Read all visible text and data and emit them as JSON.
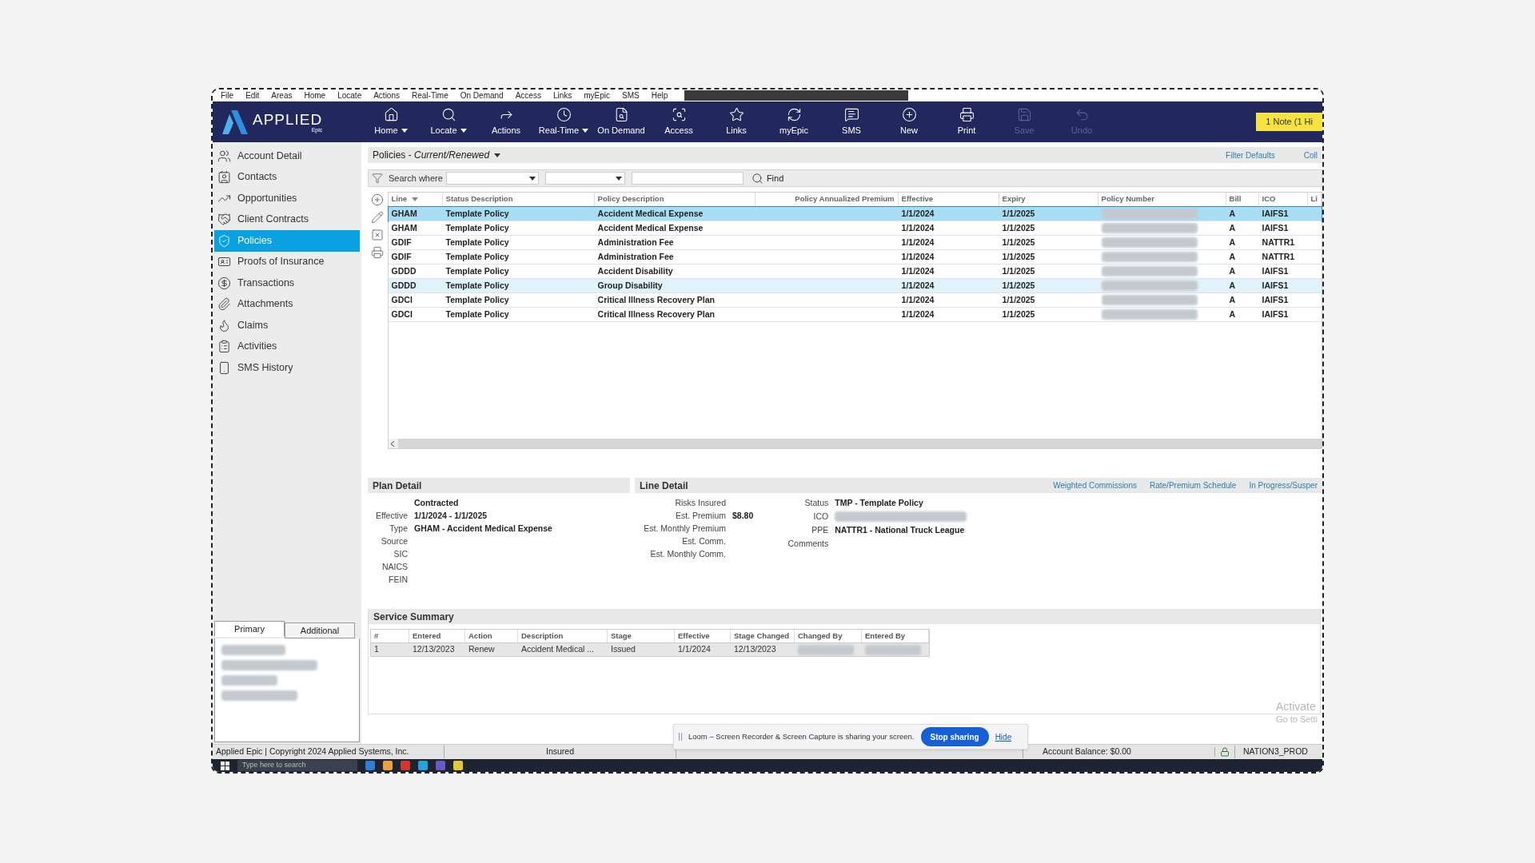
{
  "menu_bar": [
    "File",
    "Edit",
    "Areas",
    "Home",
    "Locate",
    "Actions",
    "Real-Time",
    "On Demand",
    "Access",
    "Links",
    "myEpic",
    "SMS",
    "Help"
  ],
  "toolbar": {
    "logo": "APPLIED",
    "logo_sub": "Epic",
    "buttons": [
      {
        "label": "Home",
        "dropdown": true,
        "disabled": false
      },
      {
        "label": "Locate",
        "dropdown": true,
        "disabled": false
      },
      {
        "label": "Actions",
        "dropdown": false,
        "disabled": false
      },
      {
        "label": "Real-Time",
        "dropdown": true,
        "disabled": false
      },
      {
        "label": "On Demand",
        "dropdown": false,
        "disabled": false
      },
      {
        "label": "Access",
        "dropdown": false,
        "disabled": false
      },
      {
        "label": "Links",
        "dropdown": false,
        "disabled": false
      },
      {
        "label": "myEpic",
        "dropdown": false,
        "disabled": false
      },
      {
        "label": "SMS",
        "dropdown": false,
        "disabled": false
      },
      {
        "label": "New",
        "dropdown": false,
        "disabled": false
      },
      {
        "label": "Print",
        "dropdown": false,
        "disabled": false
      },
      {
        "label": "Save",
        "dropdown": false,
        "disabled": true
      },
      {
        "label": "Undo",
        "dropdown": false,
        "disabled": true
      }
    ],
    "note_badge": "1 Note (1 Hi"
  },
  "sidebar": {
    "items": [
      {
        "label": "Account Detail",
        "selected": false
      },
      {
        "label": "Contacts",
        "selected": false
      },
      {
        "label": "Opportunities",
        "selected": false
      },
      {
        "label": "Client Contracts",
        "selected": false
      },
      {
        "label": "Policies",
        "selected": true
      },
      {
        "label": "Proofs of Insurance",
        "selected": false
      },
      {
        "label": "Transactions",
        "selected": false
      },
      {
        "label": "Attachments",
        "selected": false
      },
      {
        "label": "Claims",
        "selected": false
      },
      {
        "label": "Activities",
        "selected": false
      },
      {
        "label": "SMS History",
        "selected": false
      }
    ],
    "tabs": [
      {
        "label": "Primary",
        "selected": true
      },
      {
        "label": "Additional",
        "selected": false
      }
    ]
  },
  "policies": {
    "title": "Policies - *Current/Renewed*",
    "links": [
      "Filter Defaults",
      "Coll"
    ],
    "search": {
      "label": "Search where",
      "find": "Find"
    },
    "table": {
      "columns": [
        "Line",
        "Status Description",
        "Policy Description",
        "Policy Annualized Premium",
        "Effective",
        "Expiry",
        "Policy Number",
        "Bill",
        "ICO",
        "Li"
      ],
      "rows": [
        {
          "line": "GHAM",
          "status": "Template Policy",
          "description": "Accident Medical Expense",
          "effective": "1/1/2024",
          "expiry": "1/1/2025",
          "bill": "A",
          "ico": "IAIFS1",
          "selected": true,
          "hovered": false
        },
        {
          "line": "GHAM",
          "status": "Template Policy",
          "description": "Accident Medical Expense",
          "effective": "1/1/2024",
          "expiry": "1/1/2025",
          "bill": "A",
          "ico": "IAIFS1",
          "selected": false,
          "hovered": false
        },
        {
          "line": "GDIF",
          "status": "Template Policy",
          "description": "Administration Fee",
          "effective": "1/1/2024",
          "expiry": "1/1/2025",
          "bill": "A",
          "ico": "NATTR1",
          "selected": false,
          "hovered": false
        },
        {
          "line": "GDIF",
          "status": "Template Policy",
          "description": "Administration Fee",
          "effective": "1/1/2024",
          "expiry": "1/1/2025",
          "bill": "A",
          "ico": "NATTR1",
          "selected": false,
          "hovered": false
        },
        {
          "line": "GDDD",
          "status": "Template Policy",
          "description": "Accident Disability",
          "effective": "1/1/2024",
          "expiry": "1/1/2025",
          "bill": "A",
          "ico": "IAIFS1",
          "selected": false,
          "hovered": false
        },
        {
          "line": "GDDD",
          "status": "Template Policy",
          "description": "Group Disability",
          "effective": "1/1/2024",
          "expiry": "1/1/2025",
          "bill": "A",
          "ico": "IAIFS1",
          "selected": false,
          "hovered": true
        },
        {
          "line": "GDCI",
          "status": "Template Policy",
          "description": "Critical Illness Recovery Plan",
          "effective": "1/1/2024",
          "expiry": "1/1/2025",
          "bill": "A",
          "ico": "IAIFS1",
          "selected": false,
          "hovered": false
        },
        {
          "line": "GDCI",
          "status": "Template Policy",
          "description": "Critical Illness Recovery Plan",
          "effective": "1/1/2024",
          "expiry": "1/1/2025",
          "bill": "A",
          "ico": "IAIFS1",
          "selected": false,
          "hovered": false
        }
      ]
    }
  },
  "plan_detail": {
    "title": "Plan Detail",
    "fields": [
      {
        "value": "Contracted"
      },
      {
        "label": "Effective",
        "value": "1/1/2024 - 1/1/2025"
      },
      {
        "label": "Type",
        "value": "GHAM - Accident Medical Expense"
      },
      {
        "label": "Source"
      },
      {
        "label": "SIC"
      },
      {
        "label": "NAICS"
      },
      {
        "label": "FEIN"
      }
    ]
  },
  "line_detail": {
    "title": "Line Detail",
    "links": [
      "Weighted Commissions",
      "Rate/Premium Schedule",
      "In Progress/Susper"
    ],
    "fields": [
      {
        "label": "Risks Insured"
      },
      {
        "label": "Est. Premium",
        "value": "$8.80"
      },
      {
        "label": "Est. Monthly Premium"
      },
      {
        "label": "Est. Comm."
      },
      {
        "label": "Est. Monthly Comm."
      }
    ],
    "side_fields": [
      {
        "label": "Status",
        "kind": "text",
        "value": "TMP - Template Policy"
      },
      {
        "label": "ICO",
        "kind": "blurred"
      },
      {
        "label": "PPE",
        "kind": "text",
        "value": "NATTR1 - National Truck League"
      },
      {
        "label": "Comments",
        "kind": "text"
      }
    ]
  },
  "service_summary": {
    "title": "Service Summary",
    "columns": [
      "#",
      "Entered",
      "Action",
      "Description",
      "Stage",
      "Effective",
      "Stage Changed",
      "Changed By",
      "Entered By"
    ],
    "rows": [
      {
        "cells": [
          "1",
          "12/13/2023",
          "Renew",
          "Accident Medical ...",
          "Issued",
          "1/1/2024",
          "12/13/2023"
        ]
      }
    ]
  },
  "status_bar": {
    "copyright": "Applied Epic | Copyright 2024 Applied Systems, Inc.",
    "mode": "Insured",
    "balance": "Account Balance: $0.00",
    "database": "NATION3_PROD"
  },
  "overlay": {
    "message": "Loom – Screen Recorder & Screen Capture is sharing your screen.",
    "stop": "Stop sharing",
    "hide": "Hide"
  },
  "watermark": [
    "Activate",
    "Go to Setti"
  ],
  "taskbar": {
    "search_placeholder": "Type here to search"
  }
}
